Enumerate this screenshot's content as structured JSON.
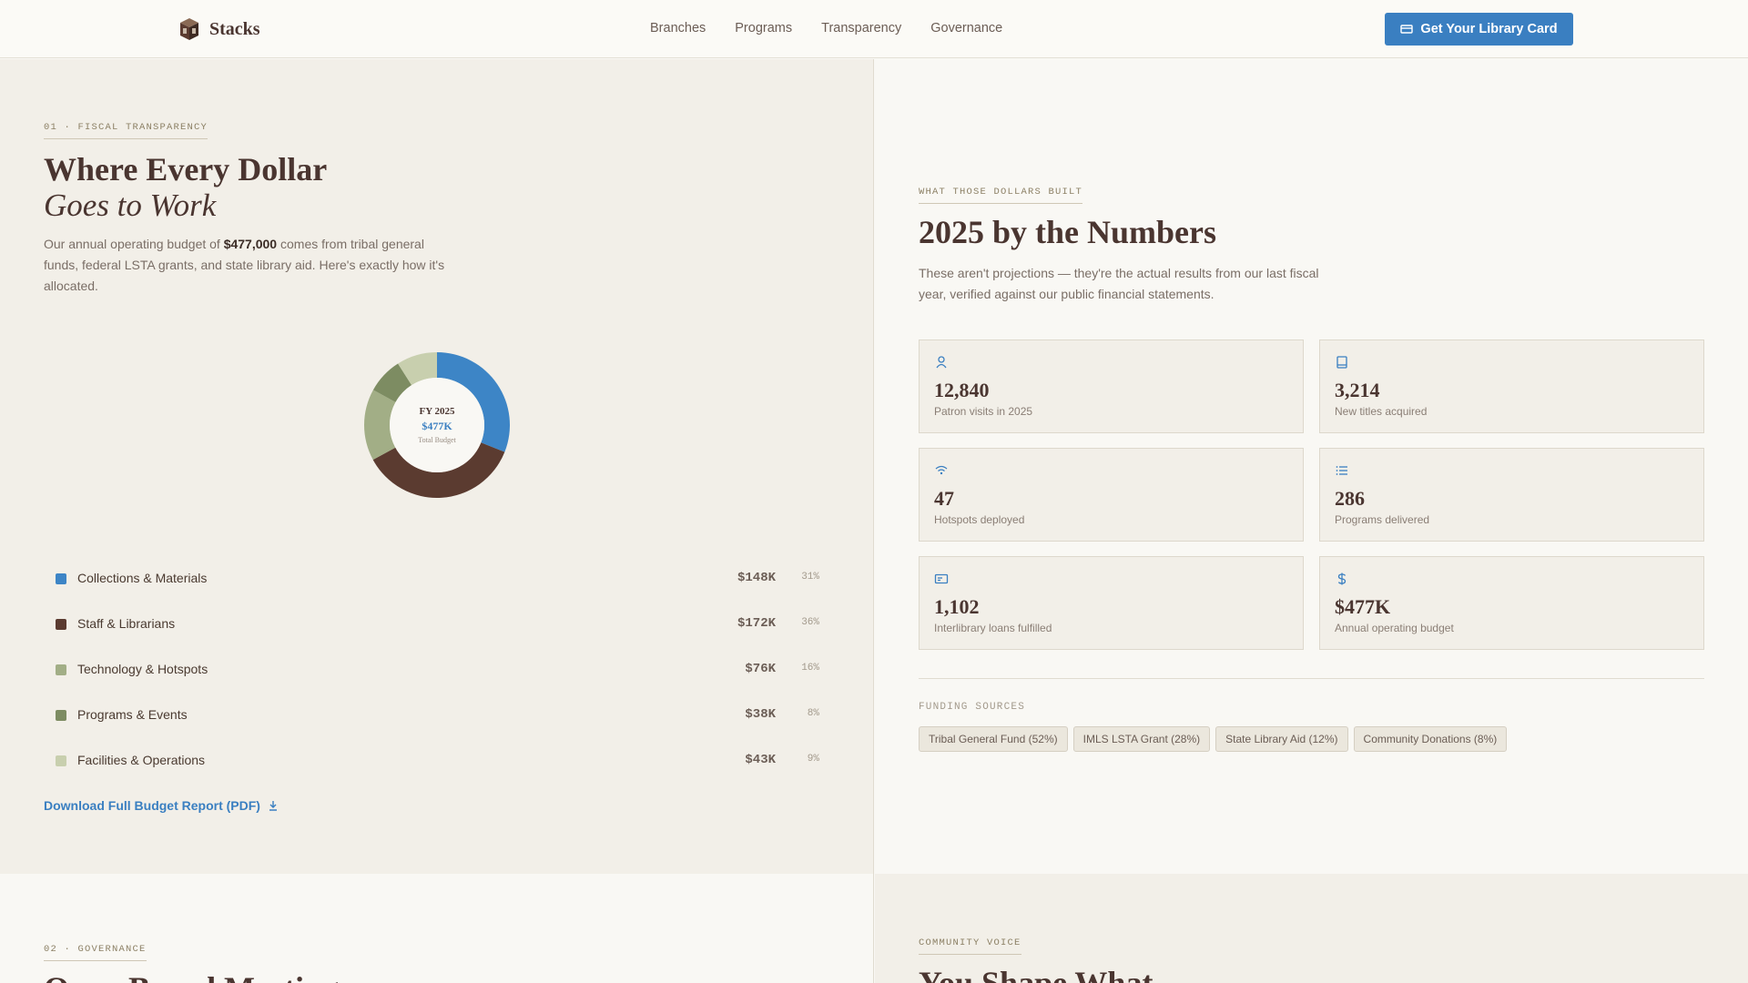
{
  "header": {
    "brand": "Stacks",
    "nav": [
      "Branches",
      "Programs",
      "Transparency",
      "Governance"
    ],
    "cta_label": "Get Your Library Card"
  },
  "fiscal": {
    "eyebrow": "01 · FISCAL TRANSPARENCY",
    "title_line1": "Where Every Dollar",
    "title_line2": "Goes to Work",
    "lede_before": "Our annual operating budget of ",
    "lede_amount": "$477,000",
    "lede_after": " comes from tribal general funds, federal LSTA grants, and state library aid. Here's exactly how it's allocated.",
    "donut_center": {
      "line1": "FY 2025",
      "line2": "$477K",
      "line3": "Total Budget"
    },
    "download_label": "Download Full Budget Report (PDF)"
  },
  "chart_data": {
    "type": "pie",
    "categories": [
      "Collections & Materials",
      "Staff & Librarians",
      "Technology & Hotspots",
      "Programs & Events",
      "Facilities & Operations"
    ],
    "values": [
      148,
      172,
      76,
      38,
      43
    ],
    "amount_labels": [
      "$148K",
      "$172K",
      "$76K",
      "$38K",
      "$43K"
    ],
    "percent_labels": [
      "31%",
      "36%",
      "16%",
      "8%",
      "9%"
    ],
    "colors": [
      "#3d85c6",
      "#5b3b30",
      "#a2ae86",
      "#7d8c62",
      "#c8cfae"
    ]
  },
  "numbers": {
    "eyebrow": "WHAT THOSE DOLLARS BUILT",
    "title": "2025 by the Numbers",
    "lede": "These aren't projections — they're the actual results from our last fiscal year, verified against our public financial statements.",
    "stats": [
      {
        "icon": "patron-icon",
        "value": "12,840",
        "label": "Patron visits in 2025"
      },
      {
        "icon": "book-icon",
        "value": "3,214",
        "label": "New titles acquired"
      },
      {
        "icon": "wifi-icon",
        "value": "47",
        "label": "Hotspots deployed"
      },
      {
        "icon": "list-icon",
        "value": "286",
        "label": "Programs delivered"
      },
      {
        "icon": "card-icon",
        "value": "1,102",
        "label": "Interlibrary loans fulfilled"
      },
      {
        "icon": "dollar-icon",
        "value": "$477K",
        "label": "Annual operating budget"
      }
    ],
    "funding_eyebrow": "FUNDING SOURCES",
    "funding": [
      "Tribal General Fund (52%)",
      "IMLS LSTA Grant (28%)",
      "State Library Aid (12%)",
      "Community Donations (8%)"
    ],
    "accent": "#3a7fc1"
  },
  "governance": {
    "eyebrow": "02 · GOVERNANCE",
    "title": "Open Board Meetings"
  },
  "community": {
    "eyebrow": "COMMUNITY VOICE",
    "title": "You Shape What"
  }
}
